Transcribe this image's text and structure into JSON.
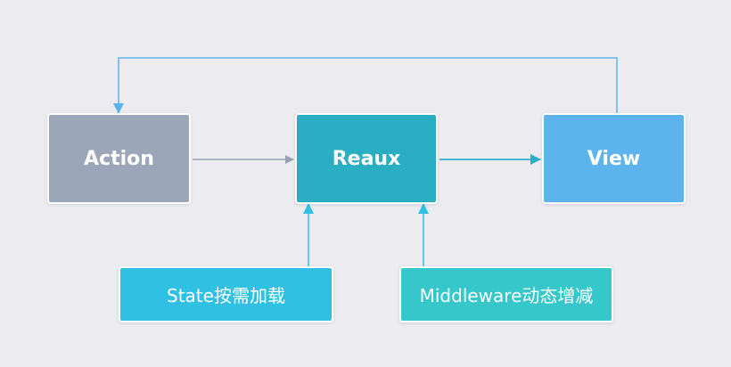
{
  "nodes": {
    "action": "Action",
    "reaux": "Reaux",
    "view": "View",
    "state": "State按需加载",
    "middleware": "Middleware动态增减"
  },
  "colors": {
    "background": "#ececf0",
    "action": "#9ba7b9",
    "reaux": "#2aaec4",
    "view": "#5db3ee",
    "state": "#2fc0e3",
    "middleware": "#36c7cb",
    "arrow_gray": "#97a1b3",
    "arrow_teal": "#2aaec4",
    "arrow_blue": "#5db3ee",
    "arrow_cyan": "#2fc0e3"
  }
}
